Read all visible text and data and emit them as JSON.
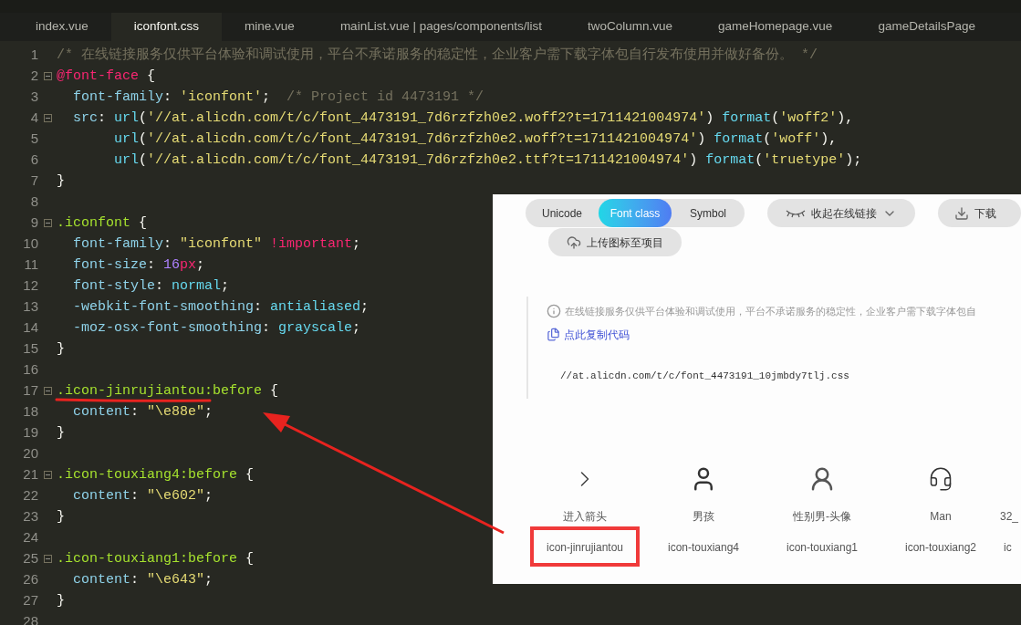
{
  "tabs": [
    {
      "label": "index.vue",
      "selected": false
    },
    {
      "label": "iconfont.css",
      "selected": true
    },
    {
      "label": "mine.vue",
      "selected": false
    },
    {
      "label": "mainList.vue | pages/components/list",
      "selected": false
    },
    {
      "label": "twoColumn.vue",
      "selected": false
    },
    {
      "label": "gameHomepage.vue",
      "selected": false
    },
    {
      "label": "gameDetailsPage",
      "selected": false
    }
  ],
  "editor": {
    "lines": [
      {
        "number": "1",
        "fold": false,
        "tokens": [
          {
            "kind": "comment",
            "text": "/* 在线链接服务仅供平台体验和调试使用，平台不承诺服务的稳定性，企业客户需下载字体包自行发布使用并做好备份。 */"
          }
        ]
      },
      {
        "number": "2",
        "fold": true,
        "tokens": [
          {
            "kind": "atrule",
            "text": "@font-face"
          },
          {
            "kind": "punct",
            "text": " {"
          }
        ]
      },
      {
        "number": "3",
        "fold": false,
        "tokens": [
          {
            "kind": "property",
            "text": "  font-family"
          },
          {
            "kind": "punct",
            "text": ": "
          },
          {
            "kind": "string",
            "text": "'iconfont'"
          },
          {
            "kind": "punct",
            "text": ";  "
          },
          {
            "kind": "comment",
            "text": "/* Project id 4473191 */"
          }
        ]
      },
      {
        "number": "4",
        "fold": true,
        "tokens": [
          {
            "kind": "property",
            "text": "  src"
          },
          {
            "kind": "punct",
            "text": ": "
          },
          {
            "kind": "func",
            "text": "url"
          },
          {
            "kind": "punct",
            "text": "("
          },
          {
            "kind": "string",
            "text": "'//at.alicdn.com/t/c/font_4473191_7d6rzfzh0e2.woff2?t=1711421004974'"
          },
          {
            "kind": "punct",
            "text": ") "
          },
          {
            "kind": "func",
            "text": "format"
          },
          {
            "kind": "punct",
            "text": "("
          },
          {
            "kind": "string",
            "text": "'woff2'"
          },
          {
            "kind": "punct",
            "text": "),"
          }
        ]
      },
      {
        "number": "5",
        "fold": false,
        "tokens": [
          {
            "kind": "func",
            "text": "       url"
          },
          {
            "kind": "punct",
            "text": "("
          },
          {
            "kind": "string",
            "text": "'//at.alicdn.com/t/c/font_4473191_7d6rzfzh0e2.woff?t=1711421004974'"
          },
          {
            "kind": "punct",
            "text": ") "
          },
          {
            "kind": "func",
            "text": "format"
          },
          {
            "kind": "punct",
            "text": "("
          },
          {
            "kind": "string",
            "text": "'woff'"
          },
          {
            "kind": "punct",
            "text": "),"
          }
        ]
      },
      {
        "number": "6",
        "fold": false,
        "tokens": [
          {
            "kind": "func",
            "text": "       url"
          },
          {
            "kind": "punct",
            "text": "("
          },
          {
            "kind": "string",
            "text": "'//at.alicdn.com/t/c/font_4473191_7d6rzfzh0e2.ttf?t=1711421004974'"
          },
          {
            "kind": "punct",
            "text": ") "
          },
          {
            "kind": "func",
            "text": "format"
          },
          {
            "kind": "punct",
            "text": "("
          },
          {
            "kind": "string",
            "text": "'truetype'"
          },
          {
            "kind": "punct",
            "text": ");"
          }
        ]
      },
      {
        "number": "7",
        "fold": false,
        "tokens": [
          {
            "kind": "punct",
            "text": "}"
          }
        ]
      },
      {
        "number": "8",
        "fold": false
      },
      {
        "number": "9",
        "fold": true,
        "tokens": [
          {
            "kind": "selector",
            "text": ".iconfont"
          },
          {
            "kind": "punct",
            "text": " {"
          }
        ]
      },
      {
        "number": "10",
        "fold": false,
        "tokens": [
          {
            "kind": "property",
            "text": "  font-family"
          },
          {
            "kind": "punct",
            "text": ": "
          },
          {
            "kind": "string",
            "text": "\"iconfont\""
          },
          {
            "kind": "keyword",
            "text": " !important"
          },
          {
            "kind": "punct",
            "text": ";"
          }
        ]
      },
      {
        "number": "11",
        "fold": false,
        "tokens": [
          {
            "kind": "property",
            "text": "  font-size"
          },
          {
            "kind": "punct",
            "text": ": "
          },
          {
            "kind": "number",
            "text": "16"
          },
          {
            "kind": "keyword",
            "text": "px"
          },
          {
            "kind": "punct",
            "text": ";"
          }
        ]
      },
      {
        "number": "12",
        "fold": false,
        "tokens": [
          {
            "kind": "property",
            "text": "  font-style"
          },
          {
            "kind": "punct",
            "text": ": "
          },
          {
            "kind": "value",
            "text": "normal"
          },
          {
            "kind": "punct",
            "text": ";"
          }
        ]
      },
      {
        "number": "13",
        "fold": false,
        "tokens": [
          {
            "kind": "property",
            "text": "  -webkit-font-smoothing"
          },
          {
            "kind": "punct",
            "text": ": "
          },
          {
            "kind": "value",
            "text": "antialiased"
          },
          {
            "kind": "punct",
            "text": ";"
          }
        ]
      },
      {
        "number": "14",
        "fold": false,
        "tokens": [
          {
            "kind": "property",
            "text": "  -moz-osx-font-smoothing"
          },
          {
            "kind": "punct",
            "text": ": "
          },
          {
            "kind": "value",
            "text": "grayscale"
          },
          {
            "kind": "punct",
            "text": ";"
          }
        ]
      },
      {
        "number": "15",
        "fold": false,
        "tokens": [
          {
            "kind": "punct",
            "text": "}"
          }
        ]
      },
      {
        "number": "16",
        "fold": false
      },
      {
        "number": "17",
        "fold": true,
        "tokens": [
          {
            "kind": "selector",
            "text": ".icon-jinrujiantou:before"
          },
          {
            "kind": "punct",
            "text": " {"
          }
        ]
      },
      {
        "number": "18",
        "fold": false,
        "tokens": [
          {
            "kind": "property",
            "text": "  content"
          },
          {
            "kind": "punct",
            "text": ": "
          },
          {
            "kind": "string",
            "text": "\"\\e88e\""
          },
          {
            "kind": "punct",
            "text": ";"
          }
        ]
      },
      {
        "number": "19",
        "fold": false,
        "tokens": [
          {
            "kind": "punct",
            "text": "}"
          }
        ]
      },
      {
        "number": "20",
        "fold": false
      },
      {
        "number": "21",
        "fold": true,
        "tokens": [
          {
            "kind": "selector",
            "text": ".icon-touxiang4:before"
          },
          {
            "kind": "punct",
            "text": " {"
          }
        ]
      },
      {
        "number": "22",
        "fold": false,
        "tokens": [
          {
            "kind": "property",
            "text": "  content"
          },
          {
            "kind": "punct",
            "text": ": "
          },
          {
            "kind": "string",
            "text": "\"\\e602\""
          },
          {
            "kind": "punct",
            "text": ";"
          }
        ]
      },
      {
        "number": "23",
        "fold": false,
        "tokens": [
          {
            "kind": "punct",
            "text": "}"
          }
        ]
      },
      {
        "number": "24",
        "fold": false
      },
      {
        "number": "25",
        "fold": true,
        "tokens": [
          {
            "kind": "selector",
            "text": ".icon-touxiang1:before"
          },
          {
            "kind": "punct",
            "text": " {"
          }
        ]
      },
      {
        "number": "26",
        "fold": false,
        "tokens": [
          {
            "kind": "property",
            "text": "  content"
          },
          {
            "kind": "punct",
            "text": ": "
          },
          {
            "kind": "string",
            "text": "\"\\e643\""
          },
          {
            "kind": "punct",
            "text": ";"
          }
        ]
      },
      {
        "number": "27",
        "fold": false,
        "tokens": [
          {
            "kind": "punct",
            "text": "}"
          }
        ]
      },
      {
        "number": "28",
        "fold": false
      }
    ]
  },
  "overlay": {
    "modes": [
      {
        "label": "Unicode",
        "selected": false
      },
      {
        "label": "Font class",
        "selected": true
      },
      {
        "label": "Symbol",
        "selected": false
      }
    ],
    "collapse_button": "收起在线链接",
    "download_button": "下载",
    "upload_button": "上传图标至项目",
    "notice": "在线链接服务仅供平台体验和调试使用，平台不承诺服务的稳定性，企业客户需下载字体包自",
    "copy_link": "点此复制代码",
    "css_url": "//at.alicdn.com/t/c/font_4473191_10jmbdy7tlj.css",
    "icons": [
      {
        "kind": "chevron",
        "name": "进入箭头",
        "class_name": "icon-jinrujiantou",
        "highlighted": true
      },
      {
        "kind": "boy",
        "name": "男孩",
        "class_name": "icon-touxiang4",
        "highlighted": false
      },
      {
        "kind": "avatar",
        "name": "性别男-头像",
        "class_name": "icon-touxiang1",
        "highlighted": false
      },
      {
        "kind": "headset",
        "name": "Man",
        "class_name": "icon-touxiang2",
        "highlighted": false
      },
      {
        "kind": "none",
        "name": "32_",
        "class_name": "ic",
        "highlighted": false
      }
    ]
  }
}
